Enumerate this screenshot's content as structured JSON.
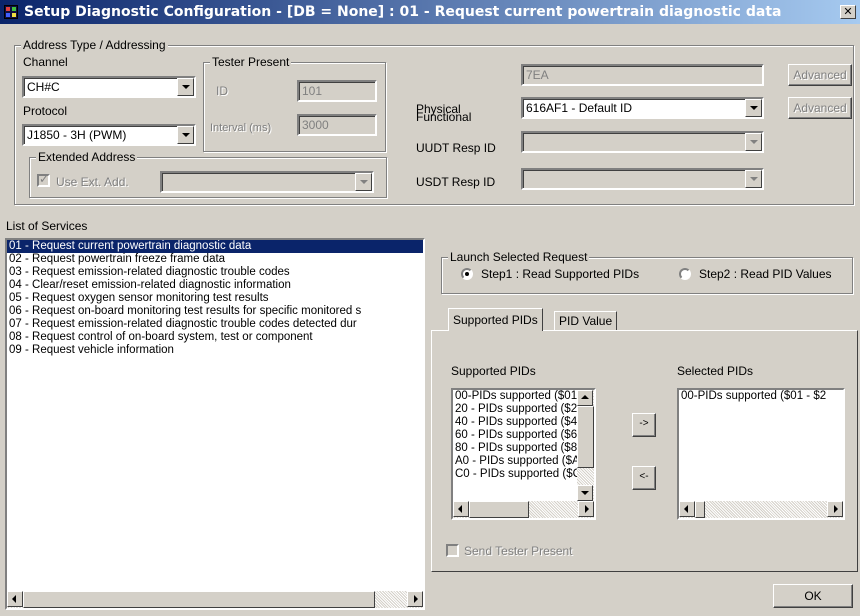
{
  "window": {
    "title": "Setup Diagnostic Configuration - [DB = None] : 01 - Request current powertrain diagnostic data"
  },
  "addressing": {
    "group_label": "Address Type / Addressing",
    "channel_label": "Channel",
    "channel_value": "CH#C",
    "protocol_label": "Protocol",
    "protocol_value": "J1850 - 3H (PWM)",
    "tester_present": {
      "group_label": "Tester Present",
      "id_label": "ID",
      "id_value": "101",
      "interval_label": "Interval (ms)",
      "interval_value": "3000"
    },
    "extended": {
      "group_label": "Extended Address",
      "use_label": "Use Ext. Add.",
      "checked": true
    },
    "physical_label": "Physical",
    "physical_value": "7EA",
    "functional_label": "Functional",
    "functional_value": "616AF1 - Default ID",
    "uudt_label": "UUDT Resp ID",
    "usdt_label": "USDT Resp ID",
    "advanced_label": "Advanced"
  },
  "services": {
    "label": "List of Services",
    "items": [
      "01 - Request current powertrain diagnostic data",
      "02 - Request powertrain freeze frame data",
      "03 - Request emission-related diagnostic trouble codes",
      "04 - Clear/reset emission-related diagnostic information",
      "05 - Request oxygen sensor monitoring test results",
      "06 - Request on-board monitoring test results for specific monitored s",
      "07 - Request emission-related diagnostic trouble codes detected dur",
      "08 - Request control of on-board system, test or component",
      "09 - Request vehicle information"
    ],
    "selected_index": 0
  },
  "launch": {
    "group_label": "Launch Selected Request",
    "step1_label": "Step1 : Read Supported PIDs",
    "step2_label": "Step2 : Read PID Values",
    "selected_step": 1
  },
  "tabs": [
    {
      "label": "Supported PIDs",
      "active": true
    },
    {
      "label": "PID Value",
      "active": false
    }
  ],
  "pids": {
    "supported_label": "Supported PIDs",
    "selected_label": "Selected PIDs",
    "supported_items": [
      "00-PIDs supported ($01",
      "20 - PIDs supported ($2",
      "40 - PIDs supported ($4",
      "60 - PIDs supported ($6",
      "80 - PIDs supported ($8",
      "A0 - PIDs supported ($A",
      "C0 - PIDs supported ($C"
    ],
    "selected_items": [
      "00-PIDs supported ($01 - $2"
    ],
    "add_label": "->",
    "remove_label": "<-"
  },
  "send_tester_present_label": "Send Tester Present",
  "ok_label": "OK"
}
